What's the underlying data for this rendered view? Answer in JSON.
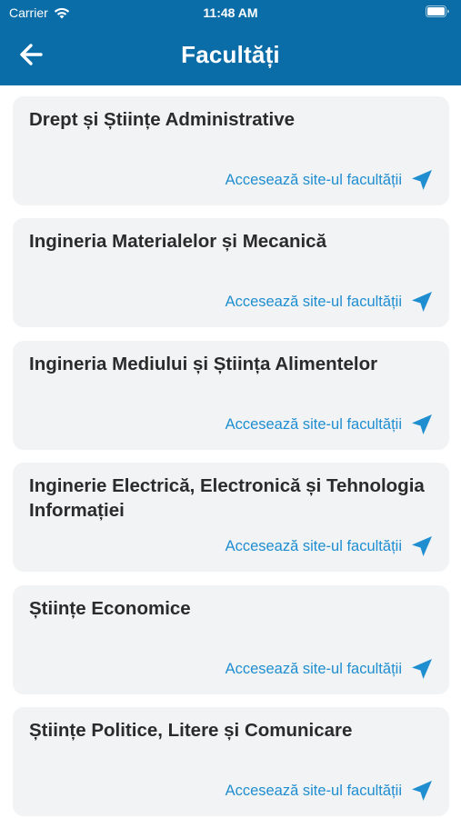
{
  "status_bar": {
    "carrier": "Carrier",
    "time": "11:48 AM"
  },
  "header": {
    "title": "Facultăți",
    "back_icon": "arrow-left-icon"
  },
  "faculties": [
    {
      "name": "Drept și Științe Administrative",
      "link_label": "Accesează site-ul facultății"
    },
    {
      "name": "Ingineria Materialelor și Mecanică",
      "link_label": "Accesează site-ul facultății"
    },
    {
      "name": "Ingineria Mediului și Știința Alimentelor",
      "link_label": "Accesează site-ul facultății"
    },
    {
      "name": "Inginerie Electrică, Electronică și Tehnologia Informației",
      "link_label": "Accesează site-ul facultății"
    },
    {
      "name": "Științe Economice",
      "link_label": "Accesează site-ul facultății"
    },
    {
      "name": "Științe Politice, Litere și Comunicare",
      "link_label": "Accesează site-ul facultății"
    }
  ],
  "colors": {
    "header_bg": "#0b6da8",
    "card_bg": "#f2f3f5",
    "link": "#1f8ed0",
    "title_text": "#2b2b2b"
  },
  "icons": {
    "link_icon": "send-icon"
  }
}
